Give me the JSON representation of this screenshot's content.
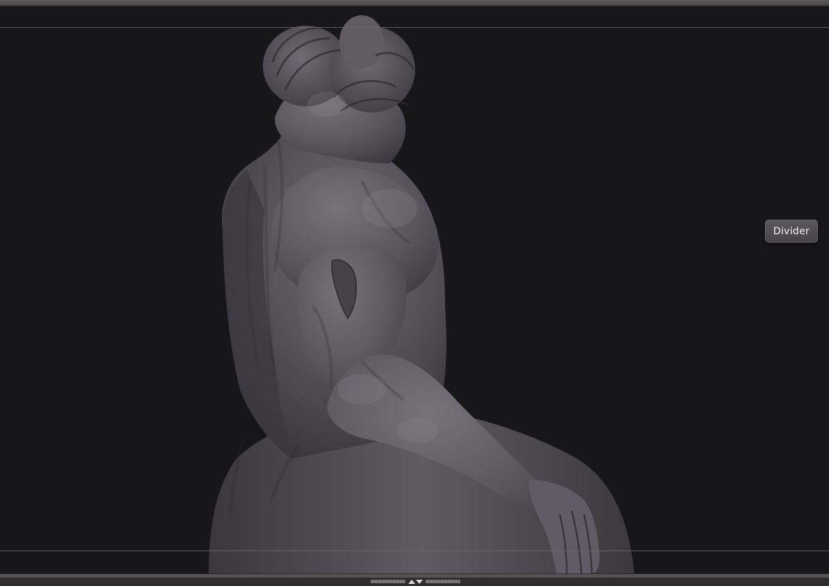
{
  "tooltip": {
    "label": "Divider"
  },
  "colors": {
    "background": "#17161a",
    "guide_line": "#6c6a6f",
    "sculpt_material": "#59555e",
    "tooltip_bg": "#4f4d50"
  },
  "icons": {
    "collapse": "collapse-expand-arrows-icon"
  }
}
